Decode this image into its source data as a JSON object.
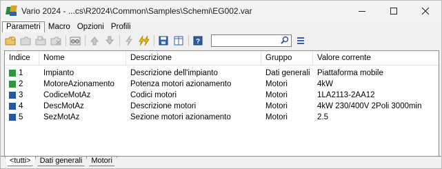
{
  "window": {
    "title": "Vario 2024 - ...cs\\R2024\\Common\\Samples\\Schemi\\EG002.var",
    "controls": {
      "minimize": "—",
      "maximize": "☐",
      "close": "✕"
    }
  },
  "menu": {
    "items": [
      {
        "label": "Parametri",
        "active": true
      },
      {
        "label": "Macro",
        "active": false
      },
      {
        "label": "Opzioni",
        "active": false
      },
      {
        "label": "Profili",
        "active": false
      }
    ]
  },
  "toolbar": {
    "search": {
      "value": "",
      "placeholder": ""
    },
    "icons": [
      "new-folder-icon",
      "edit-folder-icon",
      "copy-folder-icon",
      "delete-folder-icon",
      "binoculars-icon",
      "arrow-up-icon",
      "arrow-down-icon",
      "lightning-icon",
      "double-lightning-icon",
      "save-icon",
      "columns-icon",
      "help-icon",
      "search-icon",
      "list-icon"
    ]
  },
  "table": {
    "headers": {
      "indice": "Indice",
      "nome": "Nome",
      "descrizione": "Descrizione",
      "gruppo": "Gruppo",
      "valore": "Valore corrente"
    },
    "rows": [
      {
        "indice": "1",
        "nome": "Impianto",
        "descrizione": "Descrizione dell'impianto",
        "gruppo": "Dati generali",
        "valore": "Piattaforma mobile",
        "color": "#2a9a3c"
      },
      {
        "indice": "2",
        "nome": "MotoreAzionamento",
        "descrizione": "Potenza motori azionamento",
        "gruppo": "Motori",
        "valore": "4kW",
        "color": "#2a9a3c"
      },
      {
        "indice": "3",
        "nome": "CodiceMotAz",
        "descrizione": "Codici motori",
        "gruppo": "Motori",
        "valore": "1LA2113-2AA12",
        "color": "#1f57a8"
      },
      {
        "indice": "4",
        "nome": "DescMotAz",
        "descrizione": "Descrizione motori",
        "gruppo": "Motori",
        "valore": "4kW 230/400V 2Poli 3000min",
        "color": "#1f57a8"
      },
      {
        "indice": "5",
        "nome": "SezMotAz",
        "descrizione": "Sezione motori azionamento",
        "gruppo": "Motori",
        "valore": "2.5",
        "color": "#1f57a8"
      }
    ]
  },
  "bottom_tabs": [
    {
      "label": "<tutti>",
      "active": true
    },
    {
      "label": "Dati generali",
      "active": false
    },
    {
      "label": "Motori",
      "active": false
    }
  ]
}
